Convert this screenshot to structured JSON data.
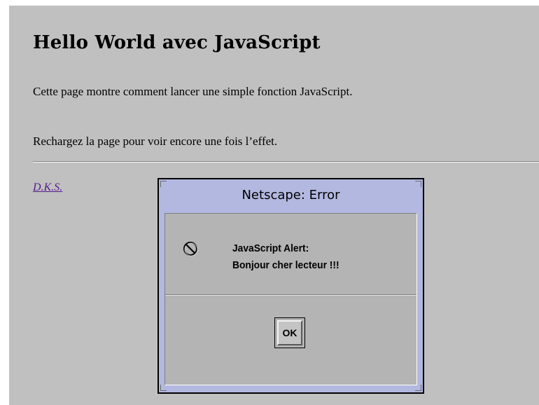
{
  "page": {
    "title": "Hello World avec JavaScript",
    "paragraph_1": "Cette page montre comment lancer une simple fonction JavaScript.",
    "paragraph_2": "Rechargez la page pour voir encore une fois l’effet.",
    "signature": "D.K.S."
  },
  "dialog": {
    "title": "Netscape: Error",
    "icon": "stop-icon",
    "message_line_1": "JavaScript Alert:",
    "message_line_2": "Bonjour cher lecteur !!!",
    "ok_label": "OK"
  },
  "colors": {
    "page_background": "#c0c0c0",
    "dialog_frame": "#b3b8e0",
    "dialog_body": "#b4b4b4",
    "link_visited": "#551a8b"
  }
}
